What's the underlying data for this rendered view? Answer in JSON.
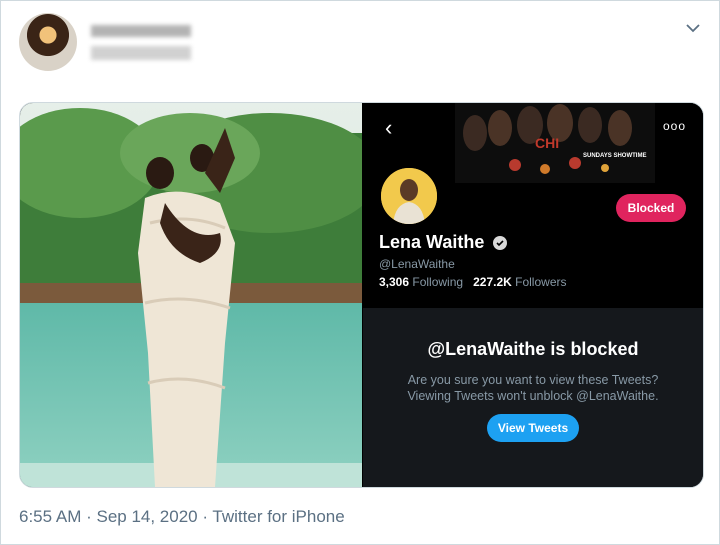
{
  "tweet": {
    "timestamp": "6:55 AM · Sep 14, 2020 · Twitter for iPhone",
    "author_icon": "blurred-avatar"
  },
  "screenshot": {
    "banner_text": "SUNDAYS SHOWTIME",
    "show_logo": "CHI",
    "profile": {
      "name": "Lena Waithe",
      "handle": "@LenaWaithe",
      "following_count": "3,306",
      "following_label": "Following",
      "followers_count": "227.2K",
      "followers_label": "Followers",
      "blocked_label": "Blocked"
    },
    "blocked_title": "@LenaWaithe is blocked",
    "blocked_line1": "Are you sure you want to view these Tweets?",
    "blocked_line2": "Viewing Tweets won't unblock @LenaWaithe.",
    "view_tweets_label": "View Tweets",
    "more_label": "ooo"
  },
  "colors": {
    "accent_blue": "#1da1f2",
    "blocked_red": "#e0245e",
    "dark_bg": "#15181c",
    "muted": "#5b7083"
  }
}
